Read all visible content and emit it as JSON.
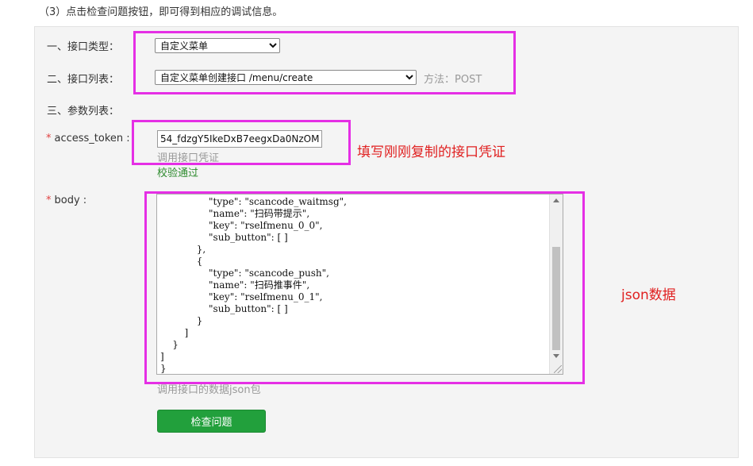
{
  "instruction": "（3）点击检查问题按钮，即可得到相应的调试信息。",
  "form": {
    "type_label": "一、接口类型：",
    "type_value": "自定义菜单",
    "list_label": "二、接口列表：",
    "list_value": "自定义菜单创建接口 /menu/create",
    "method_text": "方法：POST",
    "params_label": "三、参数列表：",
    "required_mark": "*",
    "token_label": "access_token :",
    "token_value": "54_fdzgY5IkeDxB7eegxDa0NzOM",
    "token_hint": "调用接口凭证",
    "token_status": "校验通过",
    "body_label": "body :",
    "body_text": "                \"type\": \"scancode_waitmsg\",\n                \"name\": \"扫码带提示\",\n                \"key\": \"rselfmenu_0_0\",\n                \"sub_button\": [ ]\n            },\n            {\n                \"type\": \"scancode_push\",\n                \"name\": \"扫码推事件\",\n                \"key\": \"rselfmenu_0_1\",\n                \"sub_button\": [ ]\n            }\n        ]\n    }\n]\n}",
    "body_hint": "调用接口的数据json包",
    "check_button": "检查问题"
  },
  "annotations": {
    "token_note": "填写刚刚复制的接口凭证",
    "json_note": "json数据"
  },
  "colors": {
    "highlight": "#e52fe5",
    "annotation": "#e02020",
    "button": "#22a03c",
    "ok": "#2e8b2e"
  }
}
